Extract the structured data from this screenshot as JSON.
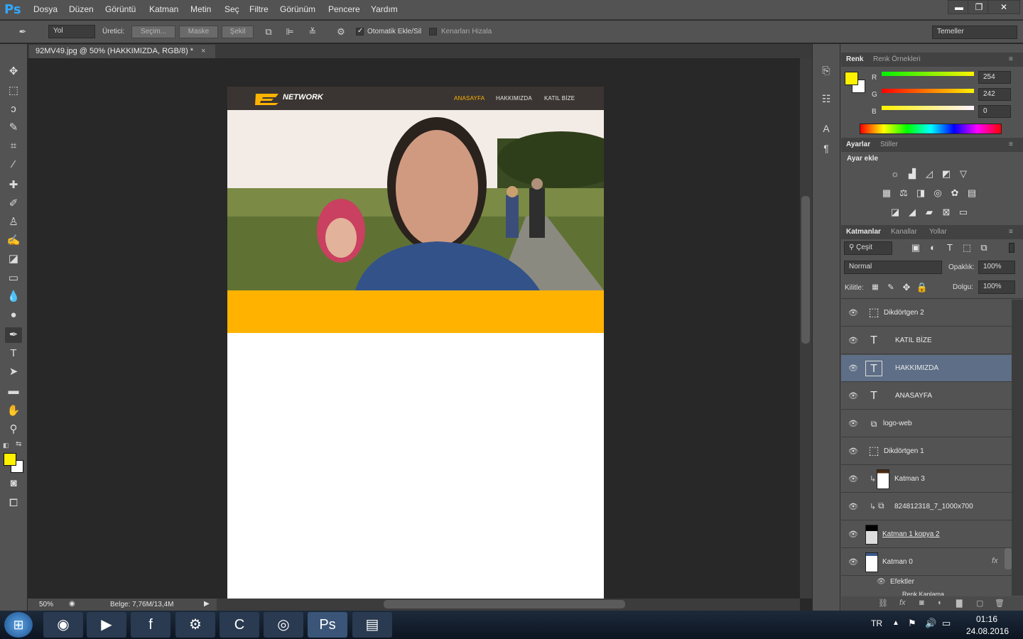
{
  "app": {
    "logo": "Ps"
  },
  "menu": [
    "Dosya",
    "Düzen",
    "Görüntü",
    "Katman",
    "Metin",
    "Seç",
    "Filtre",
    "Görünüm",
    "Pencere",
    "Yardım"
  ],
  "window": {
    "minimize": "▬",
    "restore": "❐",
    "close": "✕"
  },
  "options": {
    "mode": "Yol",
    "maker_label": "Üretici:",
    "btn_selection": "Seçim...",
    "btn_mask": "Maske",
    "btn_shape": "Şekil",
    "auto_add_label": "Otomatik Ekle/Sil",
    "align_edges_label": "Kenarları Hizala",
    "workspace": "Temeller"
  },
  "document": {
    "tab_title": "92MV49.jpg @ 50% (HAKKIMIZDA, RGB/8) *",
    "zoom": "50%",
    "doc_size": "Belge: 7,76M/13,4M"
  },
  "site": {
    "logo_text": "NETWORK",
    "nav": [
      "ANASAYFA",
      "HAKKIMIZDA",
      "KATIL BİZE"
    ],
    "band_color": "#ffb300"
  },
  "color_panel": {
    "tabs": [
      "Renk",
      "Renk Örnekleri"
    ],
    "r": "254",
    "g": "242",
    "b": "0",
    "r_label": "R",
    "g_label": "G",
    "b_label": "B",
    "fg_color": "#fef200"
  },
  "adjust_panel": {
    "tabs": [
      "Ayarlar",
      "Stiller"
    ],
    "heading": "Ayar ekle"
  },
  "layers_panel": {
    "tabs": [
      "Katmanlar",
      "Kanallar",
      "Yollar"
    ],
    "filter": "Çeşit",
    "blend": "Normal",
    "opacity_label": "Opaklık:",
    "opacity": "100%",
    "lock_label": "Kilitle:",
    "fill_label": "Dolgu:",
    "fill": "100%",
    "layers": [
      {
        "name": "Dikdörtgen 2",
        "kind": "shape"
      },
      {
        "name": "KATIL BİZE",
        "kind": "text"
      },
      {
        "name": "HAKKIMIZDA",
        "kind": "text",
        "selected": true
      },
      {
        "name": "ANASAYFA",
        "kind": "text"
      },
      {
        "name": "logo-web",
        "kind": "smart"
      },
      {
        "name": "Dikdörtgen 1",
        "kind": "shape"
      },
      {
        "name": "Katman 3",
        "kind": "pixel"
      },
      {
        "name": "824812318_7_1000x700",
        "kind": "smart"
      },
      {
        "name": "Katman 1 kopya 2",
        "kind": "pixel"
      },
      {
        "name": "Katman 0",
        "kind": "pixel"
      }
    ],
    "effects_label": "Efektler",
    "effect_sub": "Renk Kaplama",
    "fx": "fx"
  },
  "taskbar": {
    "lang": "TR",
    "time": "01:16",
    "date": "24.08.2016"
  }
}
